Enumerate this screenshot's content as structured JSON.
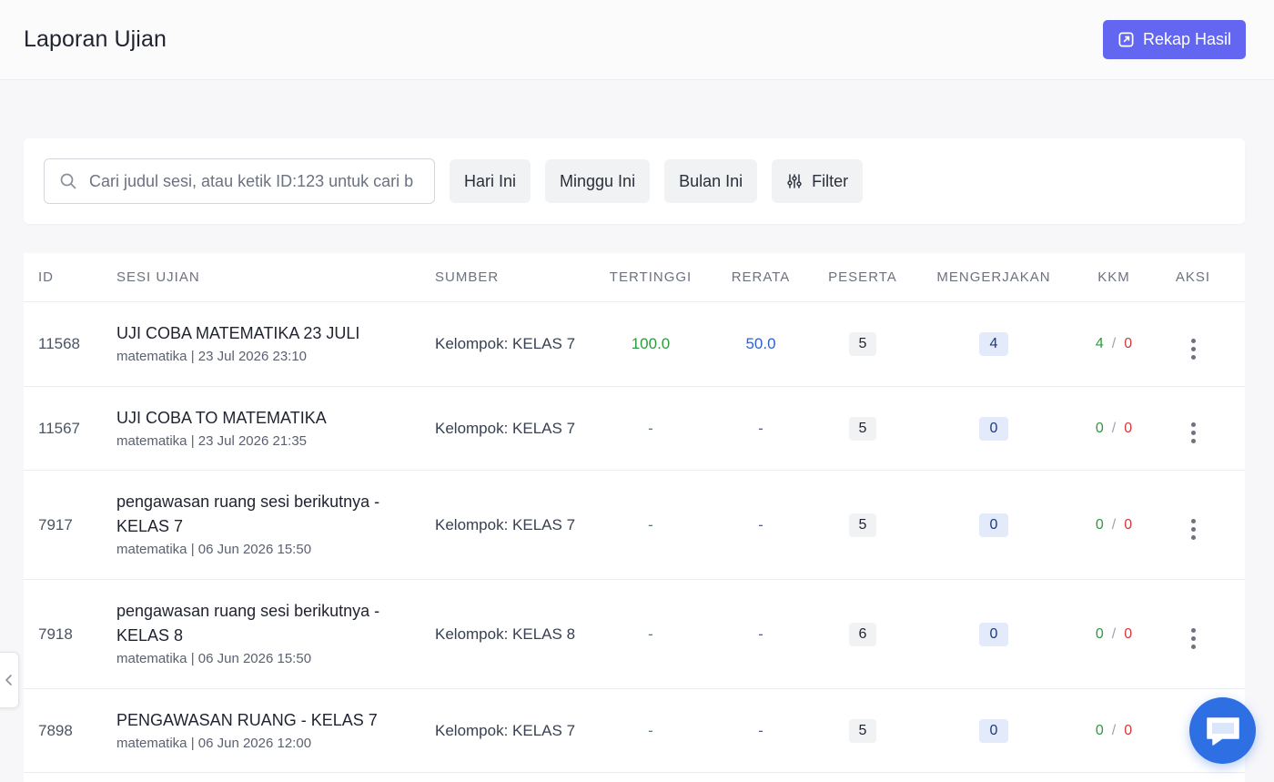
{
  "header": {
    "title": "Laporan Ujian",
    "rekap_label": "Rekap Hasil"
  },
  "filters": {
    "search_placeholder": "Cari judul sesi, atau ketik ID:123 untuk cari b",
    "chips": [
      "Hari Ini",
      "Minggu Ini",
      "Bulan Ini"
    ],
    "filter_label": "Filter"
  },
  "table": {
    "columns": [
      "ID",
      "SESI UJIAN",
      "SUMBER",
      "TERTINGGI",
      "RERATA",
      "PESERTA",
      "MENGERJAKAN",
      "KKM",
      "AKSI"
    ],
    "rows": [
      {
        "id": "11568",
        "title": "UJI COBA MATEMATIKA 23 JULI",
        "subtitle": "matematika | 23 Jul 2026 23:10",
        "source": "Kelompok: KELAS 7",
        "top": "100.0",
        "avg": "50.0",
        "peserta": "5",
        "mengerjakan": "4",
        "kkm_pass": "4",
        "kkm_fail": "0"
      },
      {
        "id": "11567",
        "title": "UJI COBA TO MATEMATIKA",
        "subtitle": "matematika | 23 Jul 2026 21:35",
        "source": "Kelompok: KELAS 7",
        "top": "-",
        "avg": "-",
        "peserta": "5",
        "mengerjakan": "0",
        "kkm_pass": "0",
        "kkm_fail": "0"
      },
      {
        "id": "7917",
        "title": "pengawasan ruang sesi berikutnya - KELAS 7",
        "subtitle": "matematika | 06 Jun 2026 15:50",
        "source": "Kelompok: KELAS 7",
        "top": "-",
        "avg": "-",
        "peserta": "5",
        "mengerjakan": "0",
        "kkm_pass": "0",
        "kkm_fail": "0"
      },
      {
        "id": "7918",
        "title": "pengawasan ruang sesi berikutnya - KELAS 8",
        "subtitle": "matematika | 06 Jun 2026 15:50",
        "source": "Kelompok: KELAS 8",
        "top": "-",
        "avg": "-",
        "peserta": "6",
        "mengerjakan": "0",
        "kkm_pass": "0",
        "kkm_fail": "0"
      },
      {
        "id": "7898",
        "title": "PENGAWASAN RUANG - KELAS 7",
        "subtitle": "matematika | 06 Jun 2026 12:00",
        "source": "Kelompok: KELAS 7",
        "top": "-",
        "avg": "-",
        "peserta": "5",
        "mengerjakan": "0",
        "kkm_pass": "0",
        "kkm_fail": "0"
      }
    ],
    "kkm_separator": "/"
  },
  "icons": {
    "rekap": "export-icon",
    "search": "search-icon",
    "filter": "sliders-icon",
    "actions": "kebab-menu-icon",
    "collapse": "chevron-left-icon",
    "chat": "chat-icon"
  },
  "colors": {
    "accent": "#6366f1",
    "highest": "#2e9a3e",
    "average": "#2f5fd0",
    "fail": "#d23b3b",
    "chat": "#2f6fe4"
  }
}
